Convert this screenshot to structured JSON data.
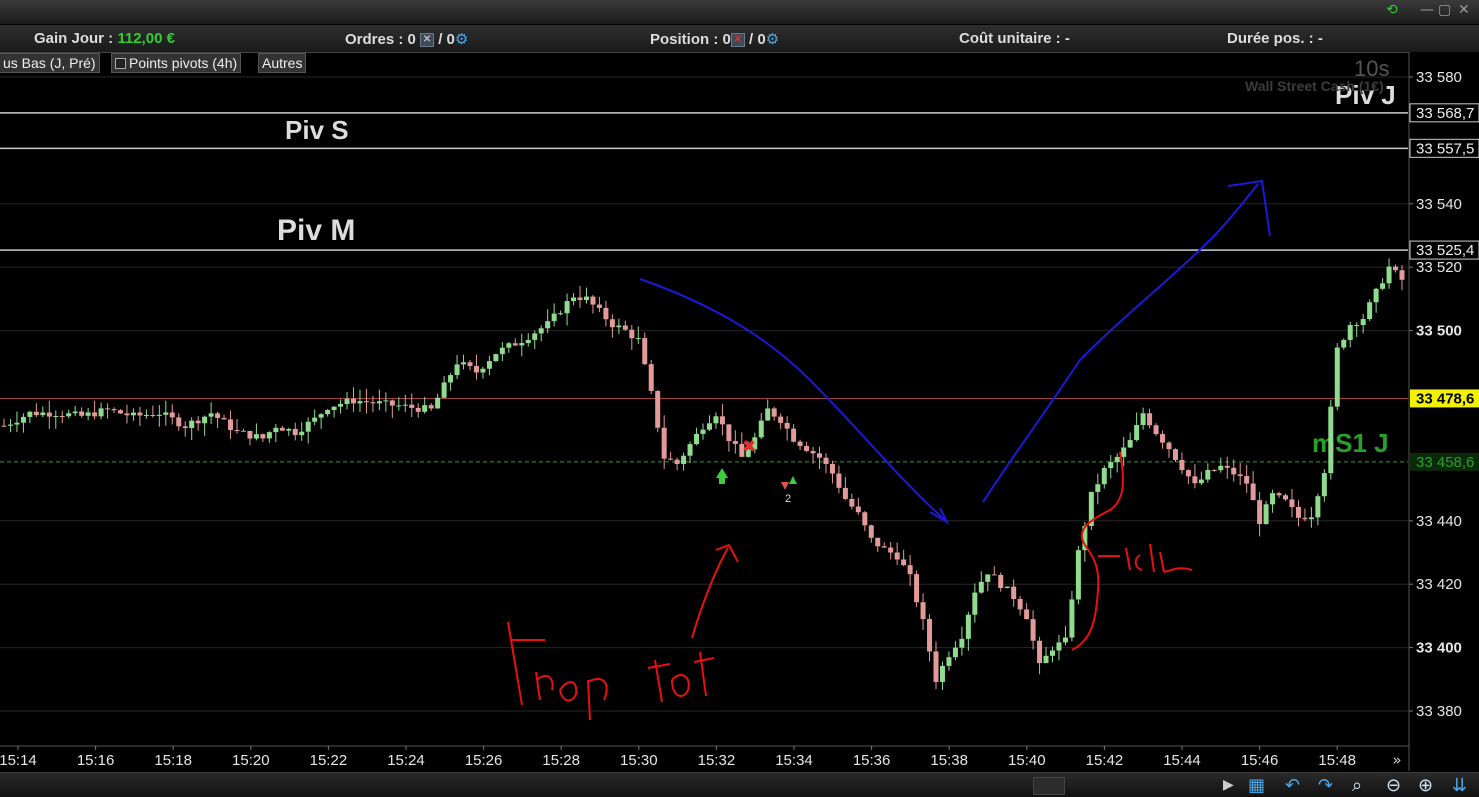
{
  "toolbar": {
    "gain_label": "Gain Jour :",
    "gain_value": "112,00 €",
    "ordres_label": "Ordres :",
    "ordres_a": "0",
    "ordres_b": "/ 0",
    "position_label": "Position :",
    "position_a": "0",
    "position_b": "/ 0",
    "cout_label": "Coût unitaire : -",
    "duree_label": "Durée pos. : -"
  },
  "indicators": {
    "hausbas": "us Bas (J, Pré)",
    "pivots": "Points pivots (4h)",
    "autres": "Autres"
  },
  "chart_overlay": {
    "timeframe": "10s",
    "instrument": "Wall Street Cash (1€)"
  },
  "colors": {
    "up": "#8fdc8f",
    "down": "#e39a9a",
    "pivot_line": "#cccccc",
    "current_price_bg": "#f2f200",
    "ms1_color": "#2aa02a",
    "annotation_red": "#e81010",
    "annotation_blue": "#1a1ad8"
  },
  "chart_data": {
    "type": "candlestick",
    "ylim": [
      33370,
      33590
    ],
    "y_ticks": [
      {
        "value": 33580,
        "label": "33 580"
      },
      {
        "value": 33540,
        "label": "33 540"
      },
      {
        "value": 33520,
        "label": "33 520"
      },
      {
        "value": 33500,
        "label": "33 500",
        "bold": true
      },
      {
        "value": 33440,
        "label": "33 440"
      },
      {
        "value": 33420,
        "label": "33 420"
      },
      {
        "value": 33400,
        "label": "33 400",
        "bold": true
      },
      {
        "value": 33380,
        "label": "33 380"
      }
    ],
    "x_ticks": [
      "15:14",
      "15:16",
      "15:18",
      "15:20",
      "15:22",
      "15:24",
      "15:26",
      "15:28",
      "15:30",
      "15:32",
      "15:34",
      "15:36",
      "15:38",
      "15:40",
      "15:42",
      "15:44",
      "15:46",
      "15:48"
    ],
    "levels": [
      {
        "name": "Piv J",
        "value": 33568.7,
        "label": "33 568,7",
        "color": "#cccccc"
      },
      {
        "name": "Piv S",
        "value": 33557.5,
        "label": "33 557,5",
        "color": "#cccccc"
      },
      {
        "name": "Piv M",
        "value": 33525.4,
        "label": "33 525,4",
        "color": "#cccccc"
      },
      {
        "name": "",
        "value": 33478.6,
        "label": "33 478,6",
        "color": "#a04040",
        "current": true
      },
      {
        "name": "mS1 J",
        "value": 33458.6,
        "label": "33 458,6",
        "color": "#2aa02a",
        "dashed": true
      }
    ],
    "price_path": [
      [
        0,
        33470
      ],
      [
        4,
        33474
      ],
      [
        8,
        33474
      ],
      [
        12,
        33473
      ],
      [
        16,
        33475
      ],
      [
        20,
        33473
      ],
      [
        24,
        33474
      ],
      [
        28,
        33470
      ],
      [
        32,
        33474
      ],
      [
        36,
        33468
      ],
      [
        40,
        33466
      ],
      [
        42,
        33470
      ],
      [
        45,
        33468
      ],
      [
        48,
        33472
      ],
      [
        50,
        33476
      ],
      [
        54,
        33478
      ],
      [
        58,
        33477
      ],
      [
        62,
        33476
      ],
      [
        66,
        33475
      ],
      [
        70,
        33490
      ],
      [
        73,
        33487
      ],
      [
        76,
        33493
      ],
      [
        80,
        33497
      ],
      [
        84,
        33502
      ],
      [
        88,
        33511
      ],
      [
        90,
        33510
      ],
      [
        92,
        33506
      ],
      [
        94,
        33502
      ],
      [
        96,
        33500
      ],
      [
        98,
        33497
      ],
      [
        100,
        33480
      ],
      [
        102,
        33460
      ],
      [
        104,
        33458
      ],
      [
        106,
        33464
      ],
      [
        108,
        33470
      ],
      [
        110,
        33474
      ],
      [
        112,
        33466
      ],
      [
        114,
        33460
      ],
      [
        116,
        33466
      ],
      [
        118,
        33475
      ],
      [
        120,
        33472
      ],
      [
        122,
        33466
      ],
      [
        124,
        33463
      ],
      [
        126,
        33460
      ],
      [
        128,
        33455
      ],
      [
        130,
        33447
      ],
      [
        132,
        33442
      ],
      [
        134,
        33434
      ],
      [
        136,
        33431
      ],
      [
        138,
        33429
      ],
      [
        140,
        33422
      ],
      [
        142,
        33408
      ],
      [
        144,
        33390
      ],
      [
        146,
        33398
      ],
      [
        148,
        33404
      ],
      [
        150,
        33418
      ],
      [
        152,
        33424
      ],
      [
        154,
        33420
      ],
      [
        156,
        33416
      ],
      [
        158,
        33410
      ],
      [
        160,
        33394
      ],
      [
        162,
        33400
      ],
      [
        164,
        33402
      ],
      [
        166,
        33430
      ],
      [
        168,
        33448
      ],
      [
        170,
        33456
      ],
      [
        172,
        33460
      ],
      [
        174,
        33465
      ],
      [
        176,
        33474
      ],
      [
        178,
        33468
      ],
      [
        180,
        33463
      ],
      [
        182,
        33457
      ],
      [
        184,
        33451
      ],
      [
        186,
        33455
      ],
      [
        188,
        33457
      ],
      [
        190,
        33455
      ],
      [
        192,
        33452
      ],
      [
        194,
        33440
      ],
      [
        196,
        33448
      ],
      [
        198,
        33446
      ],
      [
        200,
        33441
      ],
      [
        202,
        33442
      ],
      [
        204,
        33456
      ],
      [
        206,
        33494
      ],
      [
        208,
        33502
      ],
      [
        210,
        33504
      ],
      [
        212,
        33512
      ],
      [
        214,
        33520
      ],
      [
        216,
        33516
      ]
    ],
    "annotations": [
      {
        "type": "handwriting",
        "color": "red",
        "text": "Trop tot"
      },
      {
        "type": "handwriting",
        "color": "red",
        "text": "ici"
      }
    ]
  }
}
